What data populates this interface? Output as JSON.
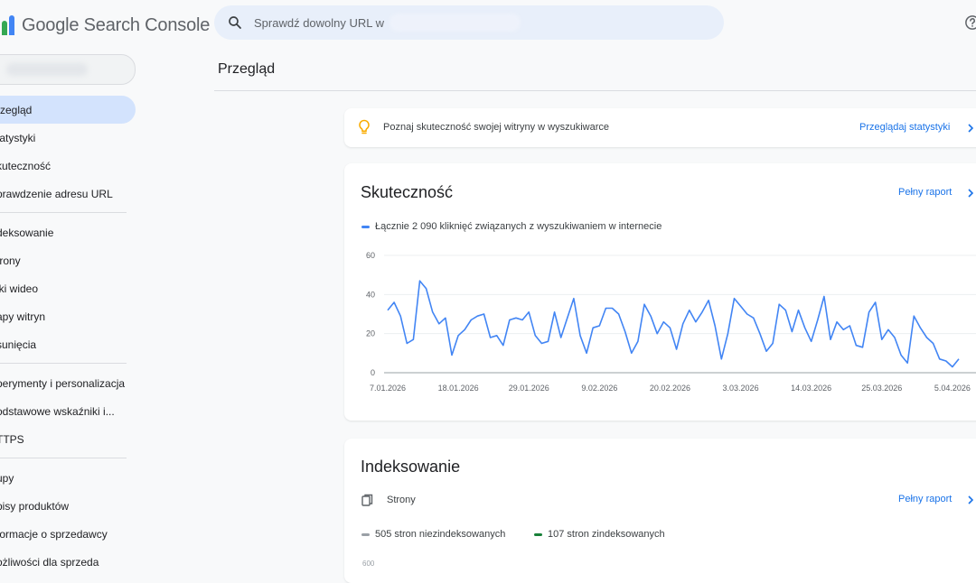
{
  "app": {
    "title": "Google Search Console"
  },
  "search": {
    "text": "Sprawdź dowolny URL w"
  },
  "sidebar": {
    "items": [
      {
        "label": "Przegląd",
        "shown": "rzegląd",
        "active": true
      },
      {
        "label": "Statystyki",
        "shown": "tatystyki"
      },
      {
        "label": "Skuteczność",
        "shown": "kuteczność"
      },
      {
        "label": "Sprawdzenie adresu URL",
        "shown": "prawdzenie adresu URL"
      },
      {
        "label": "Indeksowanie",
        "shown": "deksowanie"
      },
      {
        "label": "Strony",
        "shown": "trony"
      },
      {
        "label": "Filmy wideo",
        "shown": "iki wideo"
      },
      {
        "label": "Mapy witryn",
        "shown": "apy witryn"
      },
      {
        "label": "Usunięcia",
        "shown": "sunięcia"
      },
      {
        "label": "Eksperymenty i personalizacja",
        "shown": "perymenty i personalizacja"
      },
      {
        "label": "Podstawowe wskaźniki internetowe",
        "shown": "odstawowe wskaźniki i..."
      },
      {
        "label": "HTTPS",
        "shown": "TTPS"
      },
      {
        "label": "Zakupy",
        "shown": "upy"
      },
      {
        "label": "Opisy produktów",
        "shown": "pisy produktów"
      },
      {
        "label": "Informacje o sprzedawcy",
        "shown": "formacje o sprzedawcy"
      },
      {
        "label": "Możliwości dla sprzedawców",
        "shown": "ożliwości dla sprzeda"
      }
    ]
  },
  "main": {
    "page_title": "Przegląd",
    "tip": {
      "text": "Poznaj skuteczność swojej witryny w wyszukiwarce",
      "link": "Przeglądaj statystyki"
    },
    "performance": {
      "title": "Skuteczność",
      "link": "Pełny raport",
      "legend": "Łącznie 2 090 kliknięć związanych z wyszukiwaniem w internecie"
    },
    "indexing": {
      "title": "Indeksowanie",
      "pages_label": "Strony",
      "link": "Pełny raport",
      "legend_not_indexed": "505 stron niezindeksowanych",
      "legend_indexed": "107 stron zindeksowanych",
      "peek_tick": "600"
    }
  },
  "colors": {
    "accent": "#1a73e8",
    "series": "#4285f4",
    "tip_bulb": "#f9ab00",
    "not_indexed": "#9aa0a6",
    "indexed": "#188038"
  },
  "chart_data": {
    "type": "line",
    "ylim": [
      0,
      60
    ],
    "yticks": [
      "0",
      "20",
      "40",
      "60"
    ],
    "xtick_labels": [
      "7.01.2026",
      "18.01.2026",
      "29.01.2026",
      "9.02.2026",
      "20.02.2026",
      "3.03.2026",
      "14.03.2026",
      "25.03.2026",
      "5.04.2026"
    ],
    "xtick_index": [
      0,
      11,
      22,
      33,
      44,
      55,
      66,
      77,
      88
    ],
    "grid": true,
    "series": [
      {
        "values": [
          32,
          36,
          29,
          15,
          17,
          47,
          43,
          31,
          25,
          28,
          9,
          19,
          22,
          27,
          29,
          30,
          18,
          19,
          14,
          27,
          28,
          27,
          31,
          19,
          15,
          16,
          31,
          18,
          28,
          38,
          19,
          10,
          23,
          24,
          33,
          33,
          30,
          21,
          10,
          16,
          35,
          29,
          20,
          26,
          23,
          12,
          25,
          32,
          26,
          31,
          37,
          24,
          7,
          20,
          38,
          34,
          30,
          28,
          20,
          11,
          15,
          35,
          32,
          21,
          32,
          23,
          16,
          27,
          39,
          17,
          26,
          22,
          24,
          14,
          13,
          31,
          36,
          17,
          22,
          18,
          9,
          5,
          29,
          23,
          18,
          15,
          7,
          6,
          3,
          7
        ]
      }
    ]
  }
}
